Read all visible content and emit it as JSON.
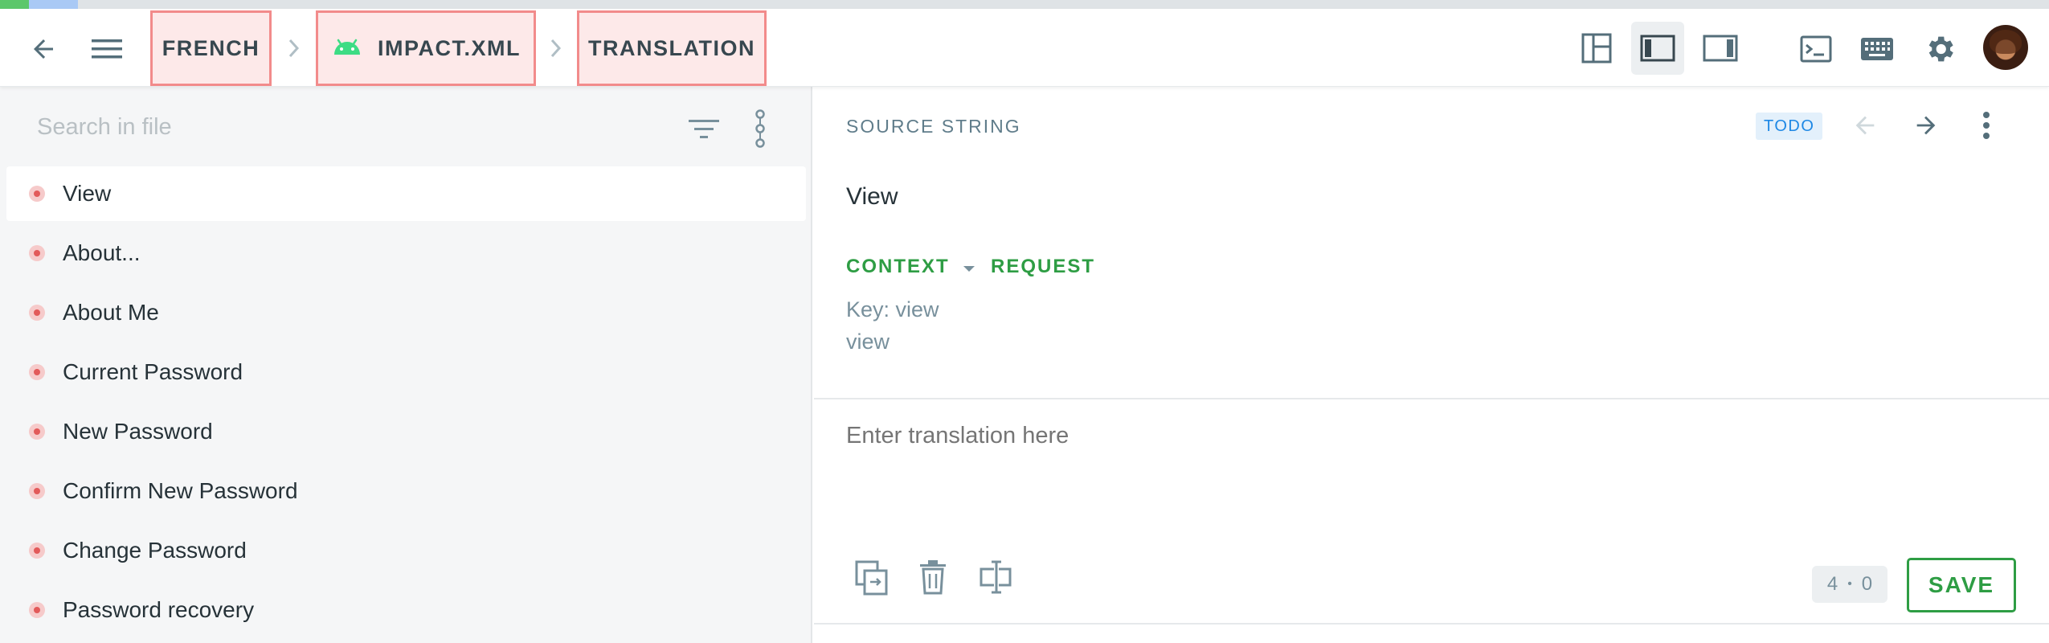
{
  "progress": {
    "translated_fraction": 0.014,
    "reviewed_fraction": 0.024
  },
  "header": {
    "breadcrumbs": [
      {
        "label": "FRENCH"
      },
      {
        "label": "IMPACT.XML",
        "icon": "android-icon"
      },
      {
        "label": "TRANSLATION"
      }
    ],
    "icons": [
      "back-arrow-icon",
      "menu-icon",
      "layout-icon",
      "sidebar-left-icon",
      "sidebar-right-icon",
      "terminal-icon",
      "keyboard-icon",
      "gear-icon"
    ]
  },
  "sidebar": {
    "search_placeholder": "Search in file",
    "items": [
      {
        "label": "View",
        "selected": true
      },
      {
        "label": "About..."
      },
      {
        "label": "About Me"
      },
      {
        "label": "Current Password"
      },
      {
        "label": "New Password"
      },
      {
        "label": "Confirm New Password"
      },
      {
        "label": "Change Password"
      },
      {
        "label": "Password recovery"
      }
    ]
  },
  "editor": {
    "section_title": "SOURCE STRING",
    "status_badge": "TODO",
    "source_text": "View",
    "tabs": {
      "context": "CONTEXT",
      "request": "REQUEST"
    },
    "context_key": "Key: view",
    "context_value": "view",
    "translation_placeholder": "Enter translation here",
    "counter": {
      "left": "4",
      "sep": "•",
      "right": "0"
    },
    "save_label": "SAVE"
  },
  "colors": {
    "accent_green": "#2e9d44",
    "badge_blue": "#1e88e5",
    "breadcrumb_highlight": "#f28b8b"
  }
}
